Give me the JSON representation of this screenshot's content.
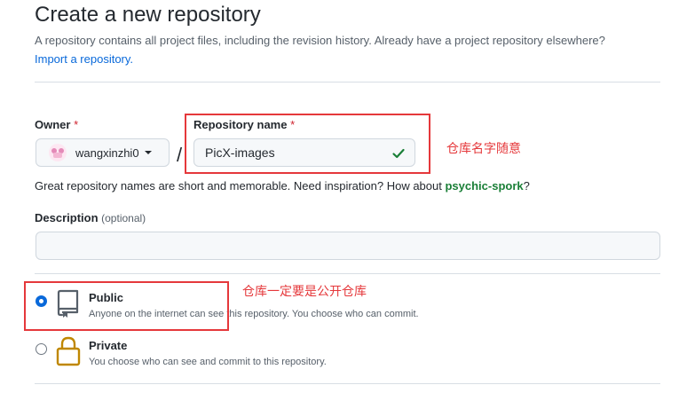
{
  "header": {
    "title": "Create a new repository",
    "subtitle": "A repository contains all project files, including the revision history. Already have a project repository elsewhere?",
    "import_link": "Import a repository."
  },
  "owner": {
    "label": "Owner",
    "required_mark": "*",
    "name": "wangxinzhi0"
  },
  "separator": "/",
  "repo_name": {
    "label": "Repository name",
    "required_mark": "*",
    "value": "PicX-images"
  },
  "name_hint": {
    "text": "Great repository names are short and memorable. Need inspiration? How about ",
    "suggestion": "psychic-spork",
    "suffix": "?"
  },
  "description": {
    "label": "Description",
    "optional": "(optional)",
    "value": ""
  },
  "visibility": {
    "options": [
      {
        "title": "Public",
        "desc": "Anyone on the internet can see this repository. You choose who can commit.",
        "selected": true,
        "icon": "repo-icon"
      },
      {
        "title": "Private",
        "desc": "You choose who can see and commit to this repository.",
        "selected": false,
        "icon": "lock-icon"
      }
    ]
  },
  "annotations": {
    "repo_note": "仓库名字随意",
    "public_note": "仓库一定要是公开仓库",
    "color": "#e5383b"
  },
  "colors": {
    "link": "#0969da",
    "success": "#1a7f37",
    "required": "#cf222e"
  }
}
